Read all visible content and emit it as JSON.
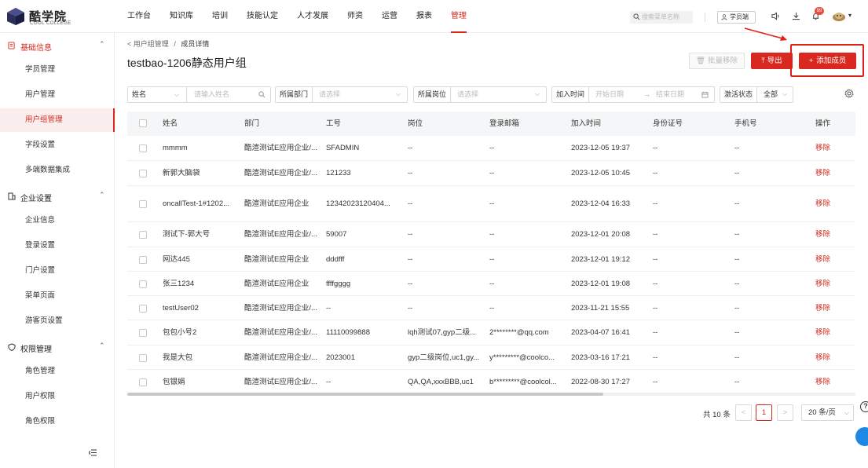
{
  "brand": {
    "name": "酷学院",
    "sub": "COOL COLLEGE",
    "accent": "#d9281f"
  },
  "nav": [
    "工作台",
    "知识库",
    "培训",
    "技能认定",
    "人才发展",
    "师资",
    "运营",
    "报表",
    "管理"
  ],
  "nav_active": "管理",
  "top": {
    "search_placeholder": "搜索菜单名称",
    "student_btn": "学员端",
    "badge": "99"
  },
  "sidebar": {
    "groups": [
      {
        "label": "基础信息",
        "items": [
          "学员管理",
          "用户管理",
          "用户组管理",
          "字段设置",
          "多端数据集成"
        ]
      },
      {
        "label": "企业设置",
        "items": [
          "企业信息",
          "登录设置",
          "门户设置",
          "菜单页面",
          "游客页设置"
        ]
      },
      {
        "label": "权限管理",
        "items": [
          "角色管理",
          "用户权限",
          "角色权限"
        ]
      }
    ],
    "active_item": "用户组管理"
  },
  "breadcrumb": {
    "parent": "用户组管理",
    "sep": "/",
    "current": "成员详情"
  },
  "page_title": "testbao-1206静态用户组",
  "actions": {
    "batch_remove": "批量移除",
    "export": "导出",
    "add_member": "添加成员"
  },
  "filters": {
    "name_select": "姓名",
    "name_placeholder": "请输入姓名",
    "dept_label": "所属部门",
    "dept_placeholder": "请选择",
    "post_label": "所属岗位",
    "post_placeholder": "请选择",
    "join_label": "加入时间",
    "start_placeholder": "开始日期",
    "range_sep": "→",
    "end_placeholder": "结束日期",
    "status_label": "激活状态",
    "status_value": "全部"
  },
  "table": {
    "columns": [
      "姓名",
      "部门",
      "工号",
      "岗位",
      "登录邮箱",
      "加入时间",
      "身份证号",
      "手机号",
      "操作"
    ],
    "rows": [
      [
        "mmmm",
        "酷渲测试E应用企业/...",
        "SFADMIN",
        "--",
        "--",
        "2023-12-05 19:37",
        "--",
        "--",
        "移除"
      ],
      [
        "新郭大脑袋",
        "酷渲测试E应用企业/...",
        "121233",
        "--",
        "--",
        "2023-12-05 10:45",
        "--",
        "--",
        "移除"
      ],
      [
        "oncallTest-1#1202...",
        "酷渲测试E应用企业",
        "12342023120404...",
        "--",
        "--",
        "2023-12-04 16:33",
        "--",
        "--",
        "移除"
      ],
      [
        "测试下-郭大号",
        "酷渲测试E应用企业/...",
        "59007",
        "--",
        "--",
        "2023-12-01 20:08",
        "--",
        "--",
        "移除"
      ],
      [
        "网达445",
        "酷渲测试E应用企业",
        "dddfff",
        "--",
        "--",
        "2023-12-01 19:12",
        "--",
        "--",
        "移除"
      ],
      [
        "张三1234",
        "酷渲测试E应用企业",
        "ffffgggg",
        "--",
        "--",
        "2023-12-01 19:08",
        "--",
        "--",
        "移除"
      ],
      [
        "testUser02",
        "酷渲测试E应用企业/...",
        "--",
        "--",
        "--",
        "2023-11-21 15:55",
        "--",
        "--",
        "移除"
      ],
      [
        "包包小号2",
        "酷渲测试E应用企业/...",
        "11110099888",
        "lqh测试07,gyp二级...",
        "2********@qq.com",
        "2023-04-07 16:41",
        "--",
        "--",
        "移除"
      ],
      [
        "我是大包",
        "酷渲测试E应用企业/...",
        "2023001",
        "gyp二级岗位,uc1,gy...",
        "y*********@coolco...",
        "2023-03-16 17:21",
        "--",
        "--",
        "移除"
      ],
      [
        "包银娟",
        "酷渲测试E应用企业/...",
        "--",
        "QA,QA,xxxBBB,uc1",
        "b*********@coolcol...",
        "2022-08-30 17:27",
        "--",
        "--",
        "移除"
      ]
    ]
  },
  "pagination": {
    "total": "共 10 条",
    "prev": "<",
    "page": "1",
    "next": ">",
    "size": "20 条/页"
  },
  "help": "?"
}
